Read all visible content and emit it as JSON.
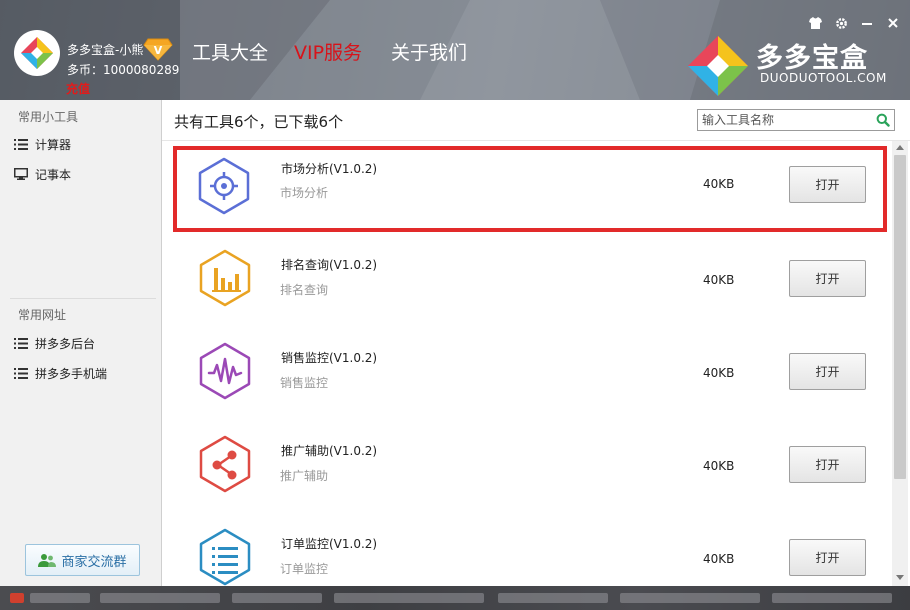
{
  "header": {
    "user": {
      "name": "多多宝盒-小熊",
      "coins": "多币：1000080289",
      "recharge": "充值"
    },
    "tabs": [
      {
        "label": "工具大全",
        "active": false
      },
      {
        "label": "VIP服务",
        "active": true
      },
      {
        "label": "关于我们",
        "active": false
      }
    ],
    "brand": {
      "name": "多多宝盒",
      "subtitle": "DUODUOTOOL.COM"
    },
    "window_controls": [
      "shirt-icon",
      "gear-icon",
      "minimize-icon",
      "close-icon"
    ]
  },
  "sidebar": {
    "tools_section": {
      "title": "常用小工具",
      "items": [
        {
          "label": "计算器",
          "icon": "list-icon"
        },
        {
          "label": "记事本",
          "icon": "monitor-icon"
        }
      ]
    },
    "links_section": {
      "title": "常用网址",
      "items": [
        {
          "label": "拼多多后台",
          "icon": "list-icon"
        },
        {
          "label": "拼多多手机端",
          "icon": "list-icon"
        }
      ]
    },
    "group_button": "商家交流群"
  },
  "main": {
    "summary": "共有工具6个，已下载6个",
    "search": {
      "placeholder": "输入工具名称"
    },
    "tools": [
      {
        "name": "市场分析(V1.0.2)",
        "desc": "市场分析",
        "size": "40KB",
        "button": "打开",
        "icon": "target-icon",
        "color": "#5b6fd6",
        "highlighted": true
      },
      {
        "name": "排名查询(V1.0.2)",
        "desc": "排名查询",
        "size": "40KB",
        "button": "打开",
        "icon": "bar-chart-icon",
        "color": "#e9a322",
        "highlighted": false
      },
      {
        "name": "销售监控(V1.0.2)",
        "desc": "销售监控",
        "size": "40KB",
        "button": "打开",
        "icon": "waveform-icon",
        "color": "#9b49b6",
        "highlighted": false
      },
      {
        "name": "推广辅助(V1.0.2)",
        "desc": "推广辅助",
        "size": "40KB",
        "button": "打开",
        "icon": "share-icon",
        "color": "#de4b43",
        "highlighted": false
      },
      {
        "name": "订单监控(V1.0.2)",
        "desc": "订单监控",
        "size": "40KB",
        "button": "打开",
        "icon": "order-list-icon",
        "color": "#2b8dc2",
        "highlighted": false
      }
    ]
  },
  "colors": {
    "accent_red": "#d8131a",
    "highlight_border": "#e22a2a",
    "search_icon": "#2aa35a"
  }
}
